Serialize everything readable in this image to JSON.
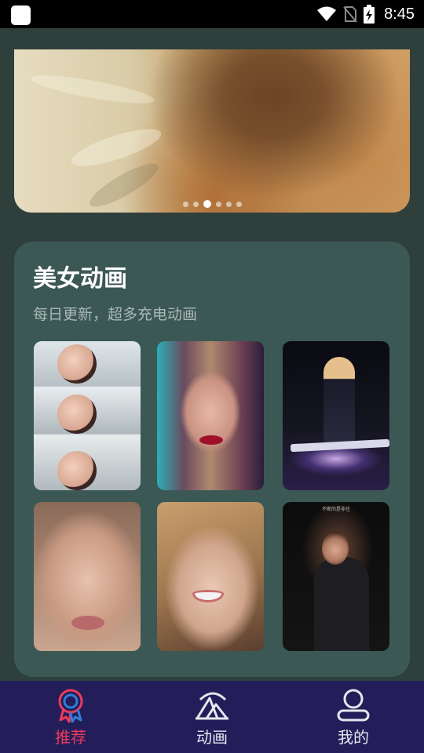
{
  "status_bar": {
    "time": "8:45",
    "icons": [
      "app-square-icon",
      "wifi-icon",
      "no-sim-icon",
      "battery-charging-icon"
    ]
  },
  "banner": {
    "page_count": 6,
    "active_page": 3
  },
  "section": {
    "title": "美女动画",
    "subtitle": "每日更新，超多充电动画",
    "thumbnails": [
      {
        "name": "thumbnail-1"
      },
      {
        "name": "thumbnail-2"
      },
      {
        "name": "thumbnail-3"
      },
      {
        "name": "thumbnail-4"
      },
      {
        "name": "thumbnail-5"
      },
      {
        "name": "thumbnail-6",
        "caption": "不断的是非往"
      }
    ]
  },
  "tabbar": {
    "tabs": [
      {
        "label": "推荐",
        "icon": "medal-icon",
        "active": true
      },
      {
        "label": "动画",
        "icon": "animation-icon",
        "active": false
      },
      {
        "label": "我的",
        "icon": "user-icon",
        "active": false
      }
    ],
    "colors": {
      "active": "#ee3a5a",
      "inactive": "#e6e6ee",
      "background": "#231e5a"
    }
  }
}
